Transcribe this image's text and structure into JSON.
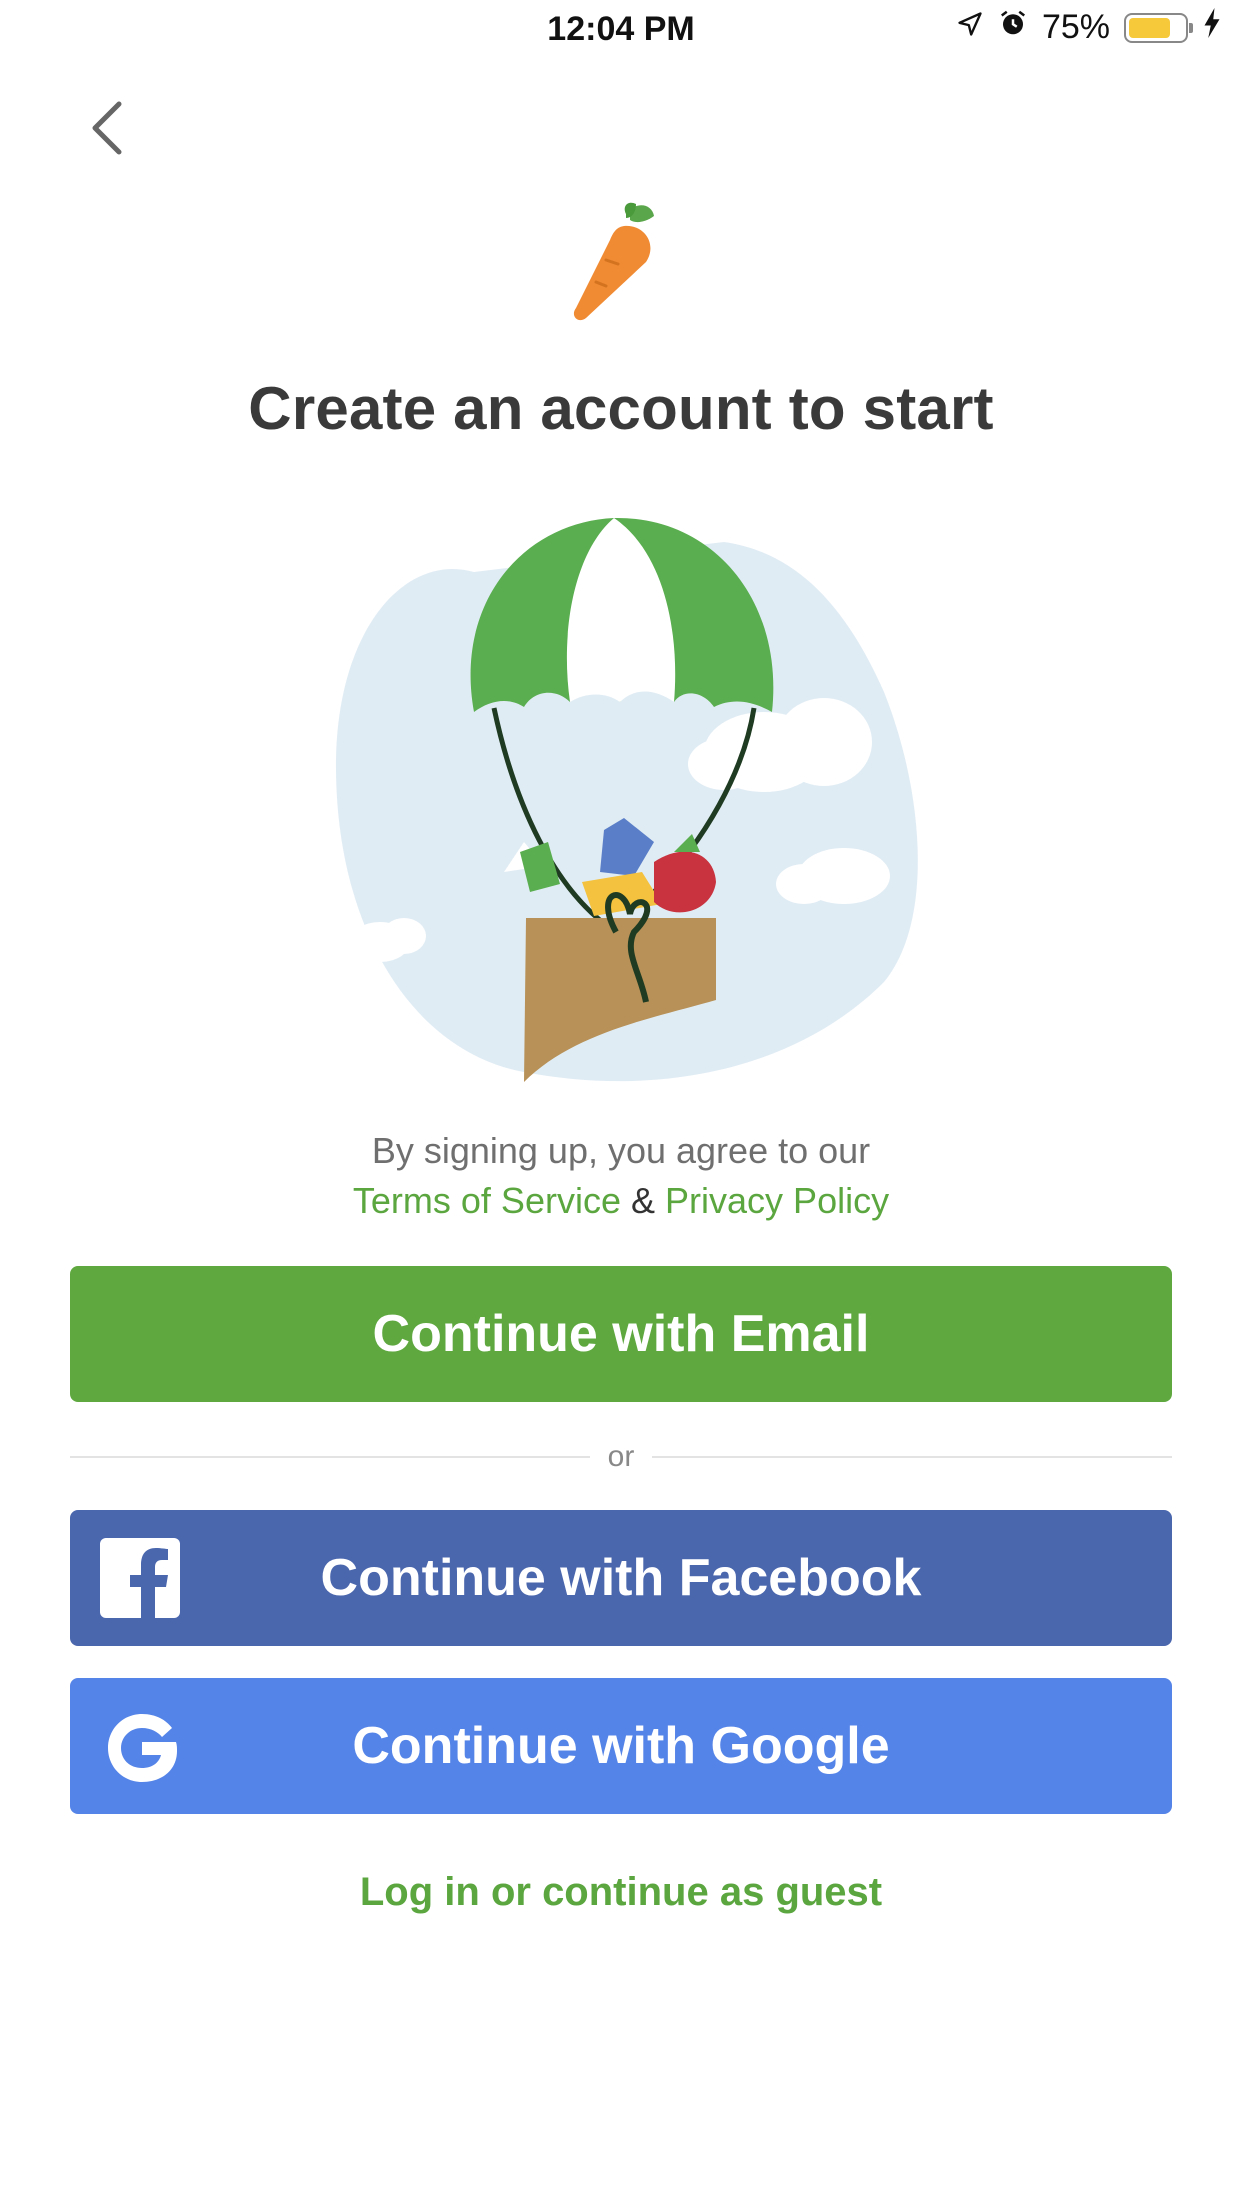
{
  "status_bar": {
    "time": "12:04 PM",
    "battery_percent": "75%",
    "battery_level": 0.75
  },
  "header": {
    "back_icon": "chevron-left-icon"
  },
  "title": "Create an account to start",
  "terms": {
    "prefix": "By signing up, you agree to our",
    "terms_link": "Terms of Service",
    "separator": "&",
    "privacy_link": "Privacy Policy"
  },
  "buttons": {
    "email": "Continue with Email",
    "divider": "or",
    "facebook": "Continue with Facebook",
    "google": "Continue with Google"
  },
  "guest_link": "Log in or continue as guest",
  "colors": {
    "brand_green": "#5ea83f",
    "facebook_blue": "#4a66ad",
    "google_blue": "#5584e8"
  }
}
